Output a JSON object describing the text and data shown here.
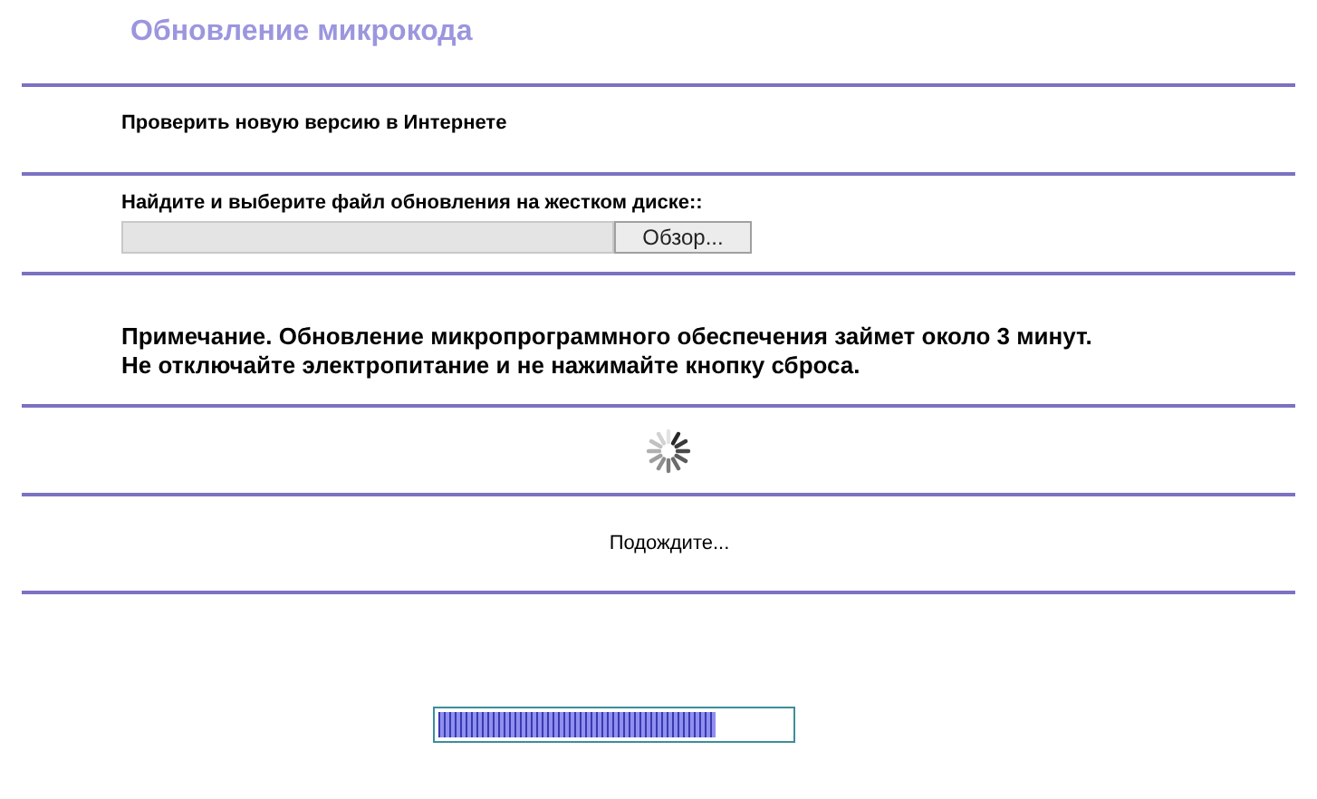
{
  "title": "Обновление микрокода",
  "check_online": "Проверить новую версию в Интернете",
  "file_label": "Найдите и выберите файл обновления на жестком диске::",
  "browse_button": "Обзор...",
  "note": [
    "Примечание. Обновление микропрограммного обеспечения займет около 3 минут.",
    "Не отключайте электропитание и не нажимайте кнопку сброса."
  ],
  "wait_text": "Подождите...",
  "progress": {
    "level": 0.79
  }
}
